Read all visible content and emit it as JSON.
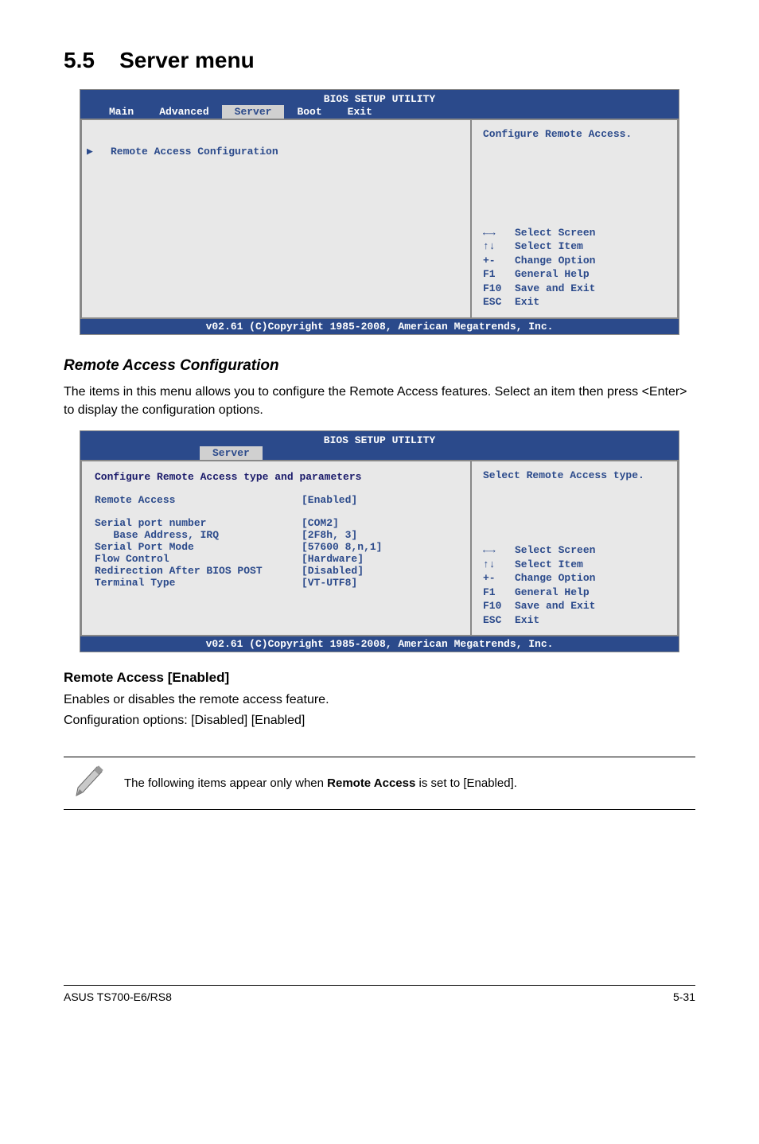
{
  "section": {
    "number": "5.5",
    "title": "Server menu"
  },
  "bios1": {
    "title": "BIOS SETUP UTILITY",
    "menu": [
      "Main",
      "Advanced",
      "Server",
      "Boot",
      "Exit"
    ],
    "selected": "Server",
    "main_item": "Remote Access Configuration",
    "side_desc": "Configure Remote Access.",
    "keys": [
      {
        "k": "←→",
        "v": "Select Screen"
      },
      {
        "k": "↑↓",
        "v": "Select Item"
      },
      {
        "k": "+-",
        "v": "Change Option"
      },
      {
        "k": "F1",
        "v": "General Help"
      },
      {
        "k": "F10",
        "v": "Save and Exit"
      },
      {
        "k": "ESC",
        "v": "Exit"
      }
    ],
    "footer": "v02.61 (C)Copyright 1985-2008, American Megatrends, Inc."
  },
  "remote_cfg": {
    "heading": "Remote Access Configuration",
    "desc": "The items in this menu allows you to configure the Remote Access features. Select an item then press <Enter> to display the configuration options."
  },
  "bios2": {
    "title": "BIOS SETUP UTILITY",
    "selected": "Server",
    "header_line": "Configure Remote Access type and parameters",
    "rows": [
      {
        "label": "Remote Access",
        "value": "[Enabled]"
      },
      {
        "label": "",
        "value": ""
      },
      {
        "label": "Serial port number",
        "value": "[COM2]"
      },
      {
        "label": "   Base Address, IRQ",
        "value": "[2F8h, 3]"
      },
      {
        "label": "Serial Port Mode",
        "value": "[57600 8,n,1]"
      },
      {
        "label": "Flow Control",
        "value": "[Hardware]"
      },
      {
        "label": "Redirection After BIOS POST",
        "value": "[Disabled]"
      },
      {
        "label": "Terminal Type",
        "value": "[VT-UTF8]"
      }
    ],
    "side_desc": "Select Remote Access type.",
    "keys": [
      {
        "k": "←→",
        "v": "Select Screen"
      },
      {
        "k": "↑↓",
        "v": "Select Item"
      },
      {
        "k": "+-",
        "v": "Change Option"
      },
      {
        "k": "F1",
        "v": "General Help"
      },
      {
        "k": "F10",
        "v": "Save and Exit"
      },
      {
        "k": "ESC",
        "v": "Exit"
      }
    ],
    "footer": "v02.61 (C)Copyright 1985-2008, American Megatrends, Inc."
  },
  "remote_access": {
    "heading": "Remote Access [Enabled]",
    "line1": "Enables or disables the remote access feature.",
    "line2": "Configuration options: [Disabled] [Enabled]"
  },
  "note": {
    "pre": "The following items appear only when ",
    "bold": "Remote Access",
    "post": " is set to [Enabled]."
  },
  "footer": {
    "left": "ASUS TS700-E6/RS8",
    "right": "5-31"
  }
}
